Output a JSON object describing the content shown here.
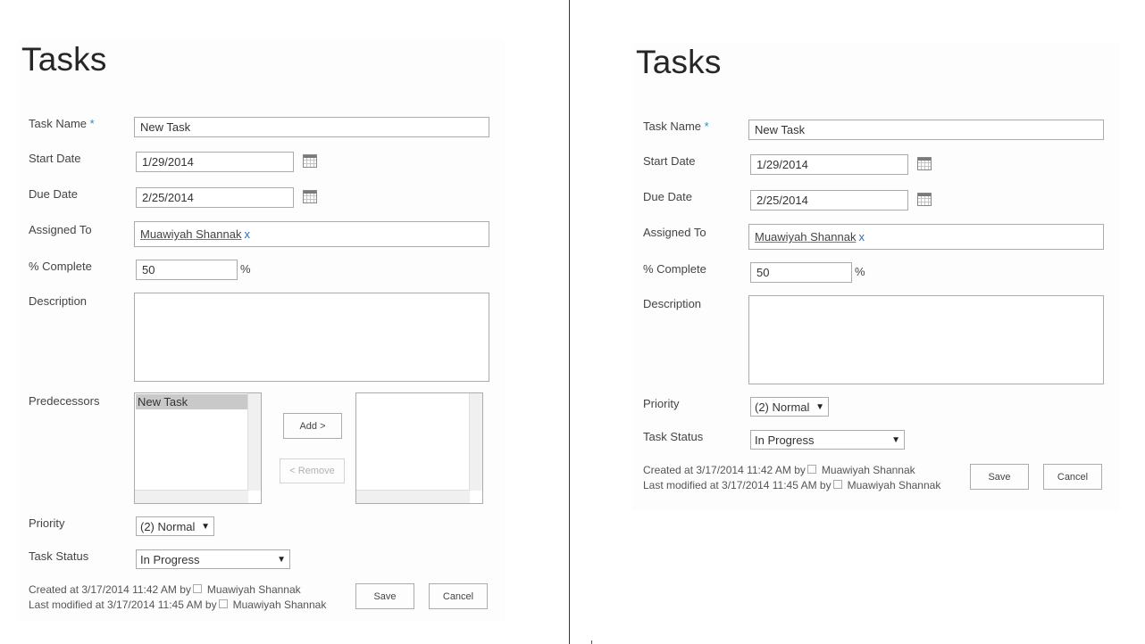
{
  "left": {
    "title": "Tasks",
    "fields": {
      "task_name": {
        "label": "Task Name",
        "required": "*",
        "value": "New Task"
      },
      "start_date": {
        "label": "Start Date",
        "value": "1/29/2014"
      },
      "due_date": {
        "label": "Due Date",
        "value": "2/25/2014"
      },
      "assigned_to": {
        "label": "Assigned To",
        "person": "Muawiyah Shannak",
        "remove": "x"
      },
      "percent_complete": {
        "label": "% Complete",
        "value": "50",
        "unit": "%"
      },
      "description": {
        "label": "Description",
        "value": ""
      },
      "predecessors": {
        "label": "Predecessors",
        "available": [
          "New Task"
        ],
        "add": "Add >",
        "remove": "< Remove"
      },
      "priority": {
        "label": "Priority",
        "value": "(2) Normal"
      },
      "task_status": {
        "label": "Task Status",
        "value": "In Progress"
      }
    },
    "footer": {
      "created": "Created at 3/17/2014 11:42 AM  by",
      "created_by": "Muawiyah Shannak",
      "modified": "Last modified at 3/17/2014 11:45 AM  by",
      "modified_by": "Muawiyah Shannak",
      "save": "Save",
      "cancel": "Cancel"
    }
  },
  "right": {
    "title": "Tasks",
    "fields": {
      "task_name": {
        "label": "Task Name",
        "required": "*",
        "value": "New Task"
      },
      "start_date": {
        "label": "Start Date",
        "value": "1/29/2014"
      },
      "due_date": {
        "label": "Due Date",
        "value": "2/25/2014"
      },
      "assigned_to": {
        "label": "Assigned To",
        "person": "Muawiyah Shannak",
        "remove": "x"
      },
      "percent_complete": {
        "label": "% Complete",
        "value": "50",
        "unit": "%"
      },
      "description": {
        "label": "Description",
        "value": ""
      },
      "priority": {
        "label": "Priority",
        "value": "(2) Normal"
      },
      "task_status": {
        "label": "Task Status",
        "value": "In Progress"
      }
    },
    "footer": {
      "created": "Created at 3/17/2014 11:42 AM  by",
      "created_by": "Muawiyah Shannak",
      "modified": "Last modified at 3/17/2014 11:45 AM  by",
      "modified_by": "Muawiyah Shannak",
      "save": "Save",
      "cancel": "Cancel"
    }
  },
  "icons": {
    "calendar": "calendar-icon",
    "dropdown": "▼",
    "presence": "presence-icon"
  },
  "colors": {
    "required_star": "#2a8dd4",
    "remove_x": "#2a6ebb",
    "selected_item": "#c9c9c9"
  }
}
